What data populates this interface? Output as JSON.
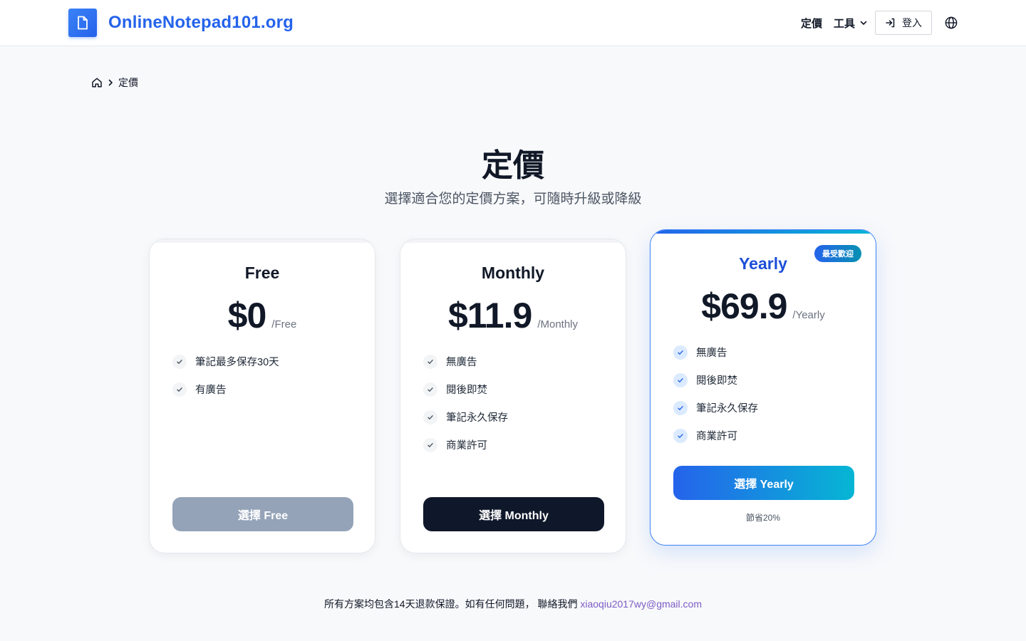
{
  "header": {
    "site_name": "OnlineNotepad101.org",
    "nav_pricing": "定價",
    "nav_tools": "工具",
    "login_label": "登入"
  },
  "breadcrumb": {
    "current": "定價"
  },
  "hero": {
    "title": "定價",
    "subtitle": "選擇適合您的定價方案，可隨時升級或降級"
  },
  "plans": [
    {
      "name": "Free",
      "price": "$0",
      "period": "/Free",
      "features": [
        "筆記最多保存30天",
        "有廣告"
      ],
      "cta": "選擇 Free"
    },
    {
      "name": "Monthly",
      "price": "$11.9",
      "period": "/Monthly",
      "features": [
        "無廣告",
        "閱後即焚",
        "筆記永久保存",
        "商業許可"
      ],
      "cta": "選擇 Monthly"
    },
    {
      "name": "Yearly",
      "price": "$69.9",
      "period": "/Yearly",
      "badge": "最受歡迎",
      "features": [
        "無廣告",
        "閱後即焚",
        "筆記永久保存",
        "商業許可"
      ],
      "cta": "選擇 Yearly",
      "note": "節省20%"
    }
  ],
  "footer": {
    "text": "所有方案均包含14天退款保證。如有任何問題， 聯絡我們",
    "email": "xiaoqiu2017wy@gmail.com"
  },
  "colors": {
    "brand": "#2563eb",
    "gradient_end": "#06b6d4",
    "free_button": "#94a3b8",
    "monthly_button": "#0f172a",
    "email_link": "#7c5cc4"
  },
  "icons": {
    "logo": "document-icon",
    "tools_dropdown": "chevron-down-icon",
    "login": "login-arrow-icon",
    "language": "globe-icon",
    "breadcrumb_home": "home-icon",
    "breadcrumb_sep": "chevron-right-icon",
    "feature": "check-icon"
  }
}
